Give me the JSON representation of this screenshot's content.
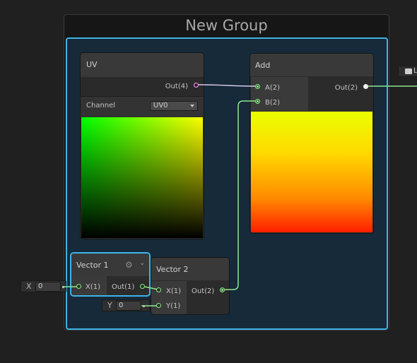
{
  "group": {
    "title": "New Group"
  },
  "uv_node": {
    "title": "UV",
    "output": "Out(4)",
    "channel_label": "Channel",
    "channel_value": "UV0"
  },
  "add_node": {
    "title": "Add",
    "inputs": [
      "A(2)",
      "B(2)"
    ],
    "output": "Out(2)"
  },
  "vector1_node": {
    "title": "Vector 1",
    "input": "X(1)",
    "output": "Out(1)",
    "x_field": {
      "label": "X",
      "value": "0"
    }
  },
  "vector2_node": {
    "title": "Vector 2",
    "inputs": [
      "X(1)",
      "Y(1)"
    ],
    "output": "Out(2)",
    "y_field": {
      "label": "Y",
      "value": "0"
    }
  },
  "right_edge_node": {
    "label": "L"
  },
  "colors": {
    "group_border": "#3fb3e6",
    "group_fill": "#162a3a",
    "wire_vector": "#8ee68e",
    "wire_uv": "#d8c8e8"
  }
}
